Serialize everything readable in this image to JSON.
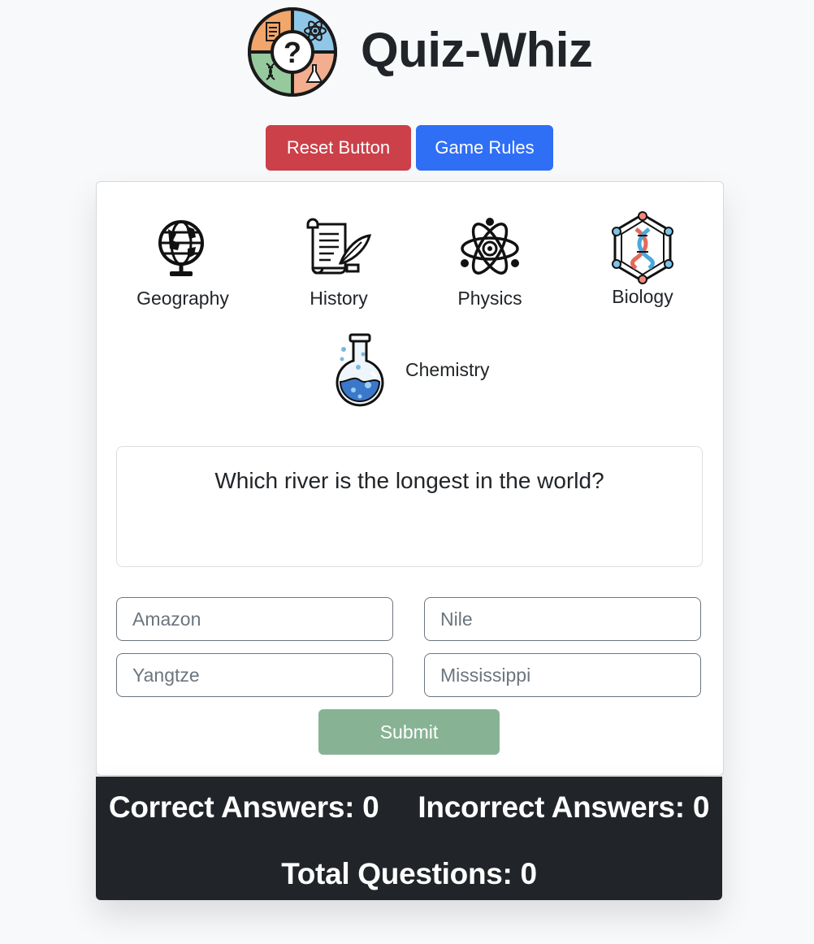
{
  "app": {
    "title": "Quiz-Whiz",
    "logo_icon": "quiz-logo-icon"
  },
  "controls": {
    "reset_label": "Reset Button",
    "rules_label": "Game Rules"
  },
  "topics": [
    {
      "label": "Geography",
      "icon": "globe-icon"
    },
    {
      "label": "History",
      "icon": "scroll-quill-icon"
    },
    {
      "label": "Physics",
      "icon": "atom-icon"
    },
    {
      "label": "Biology",
      "icon": "dna-icon"
    },
    {
      "label": "Chemistry",
      "icon": "flask-icon"
    }
  ],
  "question": {
    "text": "Which river is the longest in the world?"
  },
  "answers": [
    {
      "placeholder": "Amazon"
    },
    {
      "placeholder": "Nile"
    },
    {
      "placeholder": "Yangtze"
    },
    {
      "placeholder": "Mississippi"
    }
  ],
  "submit_label": "Submit",
  "score": {
    "correct_label": "Correct Answers:",
    "correct_value": "0",
    "incorrect_label": "Incorrect Answers:",
    "incorrect_value": "0",
    "total_label": "Total Questions:",
    "total_value": "0"
  },
  "colors": {
    "reset": "#cc4049",
    "rules": "#2f6ff6",
    "submit": "#87b394",
    "score_bg": "#212529"
  }
}
